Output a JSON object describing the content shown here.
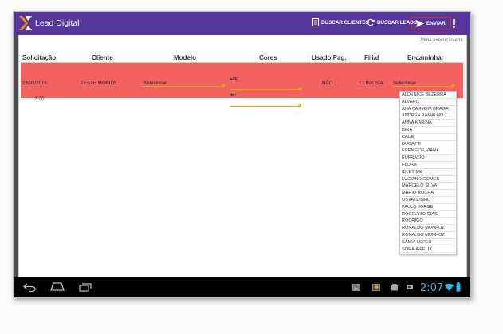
{
  "app": {
    "title": "Lead Digital"
  },
  "actions": {
    "buscar_clientes": "BUSCAR CLIENTES",
    "buscar_leads": "BUSCAR LEADS",
    "enviar": "ENVIAR"
  },
  "last_exec": "Ultima execução em",
  "columns": {
    "solicitacao": "Solicitação",
    "cliente": "Cliente",
    "modelo": "Modelo",
    "cores": "Cores",
    "usado_pag": "Usado Pag.",
    "filial": "Filial",
    "encaminhar": "Encaminhar"
  },
  "row": {
    "date": "23/03/2016",
    "time": "13:00",
    "cliente": "TESTE MOBILE",
    "modelo_placeholder": "Selecionar",
    "ext_label": "Ext:",
    "int_label": "Int:",
    "usado": "NÃO",
    "filial": "1 LINX S/A",
    "encaminhar_placeholder": "Selecionar"
  },
  "dropdown_options": [
    "ALDENICE BEZERRA",
    "ALVARO",
    "ANA CARMEM BRAGA",
    "ANDREA RAMALHO",
    "ANNA KARINA",
    "BIRA",
    "CAUE",
    "DUCATTI",
    "ERENEIDE VIANA",
    "EUFRASIO",
    "FLORA",
    "IDLETIME",
    "LUCIANO GOMES",
    "MARCELO SILVA",
    "MARIO ROCHA",
    "OSVALDINHO",
    "PAULO JORGE",
    "ROCELYTO DIAS",
    "RODRIGO",
    "RONALDO MUNHOZ",
    "RONALDO MUNHOZ",
    "SAMIA LOPES",
    "SORAIA FELIX"
  ],
  "status": {
    "time": "2:07"
  },
  "colors": {
    "app_bar": "#57369b",
    "row_highlight": "#f36161",
    "enviar_border": "#d62a2a",
    "clock": "#35b5e5"
  },
  "icons": [
    "logo-icon",
    "clientes-icon",
    "refresh-icon",
    "send-icon",
    "overflow-menu-icon",
    "back-icon",
    "home-icon",
    "recent-apps-icon",
    "gallery-icon",
    "photo-icon",
    "bag-icon",
    "sync-icon",
    "wifi-icon",
    "battery-icon"
  ]
}
